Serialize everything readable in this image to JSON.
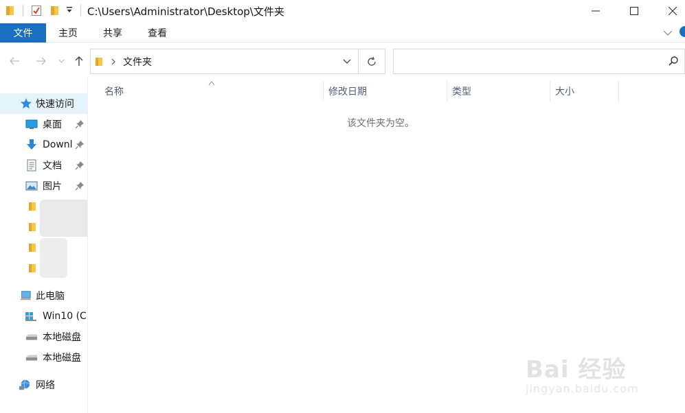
{
  "window": {
    "title": "C:\\Users\\Administrator\\Desktop\\文件夹",
    "controls": [
      "minimize",
      "maximize",
      "close"
    ]
  },
  "quick_access_toolbar": {
    "icons": [
      "folder-icon",
      "properties-icon",
      "new-folder-icon",
      "customize-dropdown-icon"
    ]
  },
  "ribbon": {
    "file_tab": "文件",
    "tabs": [
      "主页",
      "共享",
      "查看"
    ]
  },
  "address_bar": {
    "segment": "文件夹"
  },
  "search": {
    "placeholder": ""
  },
  "sidebar": {
    "quick_access": "快速访问",
    "items": [
      {
        "label": "桌面",
        "icon": "desktop-icon"
      },
      {
        "label": "Downl",
        "icon": "download-icon"
      },
      {
        "label": "文档",
        "icon": "document-icon"
      },
      {
        "label": "图片",
        "icon": "pictures-icon"
      }
    ],
    "this_pc": "此电脑",
    "drives": [
      {
        "label": "Win10 (C",
        "icon": "windows-drive-icon"
      },
      {
        "label": "本地磁盘",
        "icon": "local-disk-icon"
      },
      {
        "label": "本地磁盘",
        "icon": "local-disk-icon"
      }
    ],
    "network": "网络"
  },
  "columns": {
    "name": "名称",
    "modified": "修改日期",
    "type": "类型",
    "size": "大小"
  },
  "empty_message": "该文件夹为空。",
  "watermark": {
    "brand": "Bai 经验",
    "url": "jingyan.baidu.com"
  },
  "colors": {
    "file_tab": "#1a6fc3",
    "selected_bg": "#e5f3fb",
    "column_header_text": "#4c607a",
    "folder_yellow": "#f3c84b"
  }
}
